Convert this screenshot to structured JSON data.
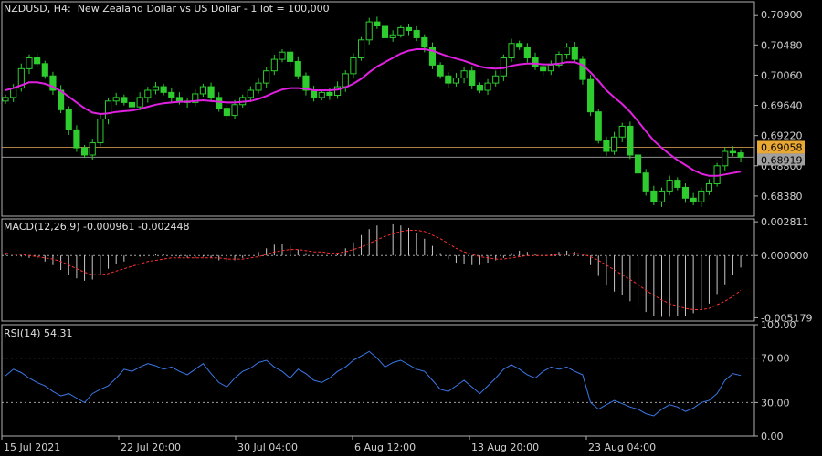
{
  "title": "NZDUSD, H4:  New Zealand Dollar vs US Dollar - 1 lot = 100,000",
  "colors": {
    "background": "#000000",
    "candle": "#2ecc2e",
    "ma_line": "#e020e0",
    "macd_hist": "#c8c8c8",
    "macd_signal": "#ff3030",
    "rsi_line": "#3a78e8",
    "ask_line": "#b08040",
    "bid_line": "#909090",
    "ask_tag": "#e8a833",
    "bid_tag": "#a0a0a0",
    "frame": "#b0b0b0",
    "levels": "#a0a0a0"
  },
  "x_axis_labels": [
    "15 Jul 2021",
    "22 Jul 20:00",
    "30 Jul 04:00",
    "6 Aug 12:00",
    "13 Aug 20:00",
    "23 Aug 04:00"
  ],
  "chart_data": [
    {
      "type": "line",
      "name": "price",
      "symbol": "NZDUSD",
      "timeframe": "H4",
      "ylim": [
        0.681,
        0.7108
      ],
      "y_ticks": [
        "0.70900",
        "0.70480",
        "0.70060",
        "0.69640",
        "0.69220",
        "0.68800",
        "0.68380"
      ],
      "ask": "0.69058",
      "bid": "0.68919",
      "close": [
        0.6975,
        0.6988,
        0.7015,
        0.703,
        0.7022,
        0.7005,
        0.6985,
        0.6958,
        0.693,
        0.6905,
        0.6895,
        0.6912,
        0.6945,
        0.697,
        0.6975,
        0.6968,
        0.6962,
        0.6975,
        0.6985,
        0.699,
        0.6982,
        0.6975,
        0.697,
        0.6968,
        0.698,
        0.699,
        0.6975,
        0.696,
        0.695,
        0.6965,
        0.6975,
        0.6985,
        0.6995,
        0.7012,
        0.7028,
        0.7038,
        0.7025,
        0.7005,
        0.6985,
        0.6975,
        0.6982,
        0.6978,
        0.699,
        0.7008,
        0.703,
        0.7055,
        0.708,
        0.7075,
        0.7058,
        0.7062,
        0.7072,
        0.7068,
        0.7058,
        0.7045,
        0.702,
        0.7005,
        0.6995,
        0.7002,
        0.7012,
        0.6992,
        0.6985,
        0.6995,
        0.7005,
        0.703,
        0.705,
        0.7045,
        0.703,
        0.7018,
        0.7012,
        0.702,
        0.7035,
        0.7045,
        0.7028,
        0.7,
        0.6955,
        0.6915,
        0.69,
        0.692,
        0.6935,
        0.6895,
        0.687,
        0.6845,
        0.683,
        0.6845,
        0.686,
        0.685,
        0.6835,
        0.683,
        0.6845,
        0.6855,
        0.688,
        0.69,
        0.6898,
        0.6892
      ],
      "moving_average": [
        0.6985,
        0.6988,
        0.6992,
        0.6996,
        0.6996,
        0.6994,
        0.699,
        0.6984,
        0.6976,
        0.6968,
        0.696,
        0.6954,
        0.6952,
        0.6953,
        0.6955,
        0.6956,
        0.6957,
        0.6959,
        0.6962,
        0.6965,
        0.6967,
        0.6968,
        0.6969,
        0.6969,
        0.697,
        0.6971,
        0.697,
        0.6969,
        0.6968,
        0.6968,
        0.6969,
        0.697,
        0.6973,
        0.6977,
        0.6982,
        0.6986,
        0.6988,
        0.6988,
        0.6987,
        0.6985,
        0.6985,
        0.6985,
        0.6986,
        0.6989,
        0.6994,
        0.7001,
        0.701,
        0.7018,
        0.7024,
        0.703,
        0.7036,
        0.704,
        0.7042,
        0.7042,
        0.704,
        0.7036,
        0.7032,
        0.7029,
        0.7026,
        0.7022,
        0.7018,
        0.7016,
        0.7015,
        0.7016,
        0.7019,
        0.7021,
        0.7022,
        0.7022,
        0.7021,
        0.7021,
        0.7022,
        0.7024,
        0.7024,
        0.702,
        0.701,
        0.6998,
        0.6985,
        0.6975,
        0.6966,
        0.6955,
        0.6942,
        0.6928,
        0.6915,
        0.6905,
        0.6896,
        0.6888,
        0.6881,
        0.6874,
        0.6869,
        0.6866,
        0.6866,
        0.6868,
        0.687,
        0.6872
      ]
    },
    {
      "type": "bar",
      "name": "MACD(12,26,9)",
      "label": "MACD(12,26,9) -0.000961 -0.002448",
      "ylim": [
        -0.00545,
        0.00305
      ],
      "y_ticks": [
        "0.002811",
        "0.000000",
        "-0.005179"
      ],
      "histogram": [
        0.0001,
        0.0,
        -0.0001,
        -0.0002,
        -0.0003,
        -0.0005,
        -0.0008,
        -0.0012,
        -0.0016,
        -0.0019,
        -0.0021,
        -0.002,
        -0.0016,
        -0.0011,
        -0.0007,
        -0.0005,
        -0.0003,
        -0.0001,
        0.0,
        0.0001,
        0.0001,
        0.0,
        -0.0001,
        -0.0002,
        -0.0002,
        -0.0001,
        -0.0002,
        -0.0004,
        -0.0005,
        -0.0004,
        -0.0002,
        0.0,
        0.0003,
        0.0006,
        0.0009,
        0.001,
        0.0008,
        0.0005,
        0.0002,
        0.0,
        0.0,
        0.0,
        0.0002,
        0.0006,
        0.0011,
        0.0017,
        0.0022,
        0.0025,
        0.0026,
        0.0026,
        0.0025,
        0.0023,
        0.0019,
        0.0014,
        0.0008,
        0.0002,
        -0.0003,
        -0.0006,
        -0.0007,
        -0.0008,
        -0.0008,
        -0.0006,
        -0.0004,
        -0.0002,
        0.0002,
        0.0004,
        0.0003,
        0.0001,
        0.0,
        0.0001,
        0.0003,
        0.0004,
        0.0003,
        0.0,
        -0.0008,
        -0.0017,
        -0.0025,
        -0.003,
        -0.0033,
        -0.0038,
        -0.0043,
        -0.0047,
        -0.005,
        -0.0051,
        -0.0051,
        -0.005,
        -0.005,
        -0.0048,
        -0.0045,
        -0.004,
        -0.0032,
        -0.0024,
        -0.0016,
        -0.001
      ],
      "signal": [
        0.0002,
        0.0001,
        0.0001,
        0.0,
        -0.0001,
        -0.0002,
        -0.0003,
        -0.0005,
        -0.0008,
        -0.0011,
        -0.0014,
        -0.0016,
        -0.0016,
        -0.0015,
        -0.0013,
        -0.0011,
        -0.0009,
        -0.0007,
        -0.0005,
        -0.0004,
        -0.0003,
        -0.0002,
        -0.0002,
        -0.0002,
        -0.0002,
        -0.0002,
        -0.0002,
        -0.0002,
        -0.0003,
        -0.0003,
        -0.0003,
        -0.0002,
        -0.0001,
        0.0001,
        0.0003,
        0.0004,
        0.0005,
        0.0005,
        0.0004,
        0.0003,
        0.0003,
        0.0002,
        0.0002,
        0.0003,
        0.0005,
        0.0007,
        0.001,
        0.0013,
        0.0016,
        0.0018,
        0.002,
        0.0021,
        0.0021,
        0.002,
        0.0017,
        0.0014,
        0.001,
        0.0006,
        0.0003,
        0.0001,
        -0.0001,
        -0.0002,
        -0.0003,
        -0.0003,
        -0.0002,
        -0.0001,
        0.0,
        0.0,
        0.0,
        0.0,
        0.0001,
        0.0001,
        0.0002,
        0.0001,
        -0.0001,
        -0.0004,
        -0.0008,
        -0.0012,
        -0.0016,
        -0.002,
        -0.0024,
        -0.0029,
        -0.0033,
        -0.0037,
        -0.004,
        -0.0042,
        -0.0044,
        -0.0045,
        -0.0045,
        -0.0044,
        -0.0041,
        -0.0038,
        -0.0034,
        -0.0029
      ]
    },
    {
      "type": "line",
      "name": "RSI(14)",
      "label": "RSI(14) 54.31",
      "ylim": [
        0,
        100
      ],
      "y_ticks": [
        "100.00",
        "70.00",
        "30.00",
        "0.00"
      ],
      "levels": [
        70,
        30
      ],
      "values": [
        54,
        60,
        57,
        52,
        48,
        45,
        40,
        36,
        38,
        34,
        30,
        38,
        42,
        45,
        52,
        60,
        58,
        62,
        65,
        63,
        60,
        62,
        58,
        55,
        60,
        65,
        56,
        48,
        44,
        52,
        58,
        61,
        66,
        68,
        62,
        58,
        52,
        60,
        56,
        50,
        48,
        52,
        58,
        62,
        68,
        72,
        76,
        70,
        62,
        66,
        68,
        64,
        60,
        58,
        50,
        42,
        40,
        45,
        50,
        44,
        38,
        45,
        52,
        60,
        64,
        60,
        55,
        52,
        58,
        62,
        60,
        62,
        58,
        55,
        30,
        24,
        28,
        32,
        29,
        26,
        24,
        20,
        18,
        24,
        28,
        26,
        22,
        25,
        30,
        32,
        38,
        50,
        56,
        54.31
      ]
    }
  ]
}
